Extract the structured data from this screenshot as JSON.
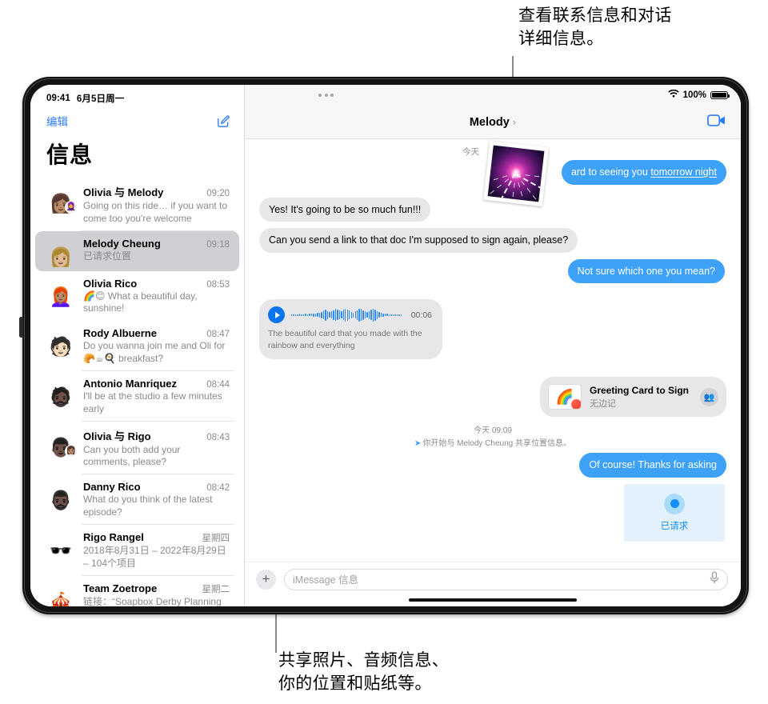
{
  "callouts": {
    "top": "查看联系信息和对话\n详细信息。",
    "bottom": "共享照片、音频信息、\n你的位置和贴纸等。"
  },
  "status_bar": {
    "time": "09:41",
    "date": "6月5日周一",
    "wifi_icon": "wifi-icon",
    "battery_percent": "100%",
    "battery_icon": "battery-icon"
  },
  "sidebar": {
    "edit_label": "编辑",
    "compose_icon": "compose-icon",
    "title": "信息",
    "conversations": [
      {
        "name": "Olivia 与 Melody",
        "time": "09:20",
        "preview": "Going on this ride… if you want to come too you're welcome",
        "avatar": "👩🏽",
        "badge": "🧕",
        "selected": false
      },
      {
        "name": "Melody Cheung",
        "time": "09:18",
        "preview": "已请求位置",
        "avatar": "👩🏼",
        "badge": "",
        "selected": true
      },
      {
        "name": "Olivia Rico",
        "time": "08:53",
        "preview": "🌈😊 What a beautiful day, sunshine!",
        "avatar": "👩🏽‍🦰",
        "badge": "",
        "selected": false
      },
      {
        "name": "Rody Albuerne",
        "time": "08:47",
        "preview": "Do you wanna join me and Oli for 🥐☕🍳 breakfast?",
        "avatar": "🧑🏻",
        "badge": "",
        "selected": false
      },
      {
        "name": "Antonio Manriquez",
        "time": "08:44",
        "preview": "I'll be at the studio a few minutes early",
        "avatar": "🧔🏿",
        "badge": "",
        "selected": false
      },
      {
        "name": "Olivia 与 Rigo",
        "time": "08:43",
        "preview": "Can you both add your comments, please?",
        "avatar": "👨🏿",
        "badge": "👩🏽",
        "selected": false
      },
      {
        "name": "Danny Rico",
        "time": "08:42",
        "preview": "What do you think of the latest episode?",
        "avatar": "🧔🏿‍♂️",
        "badge": "",
        "selected": false
      },
      {
        "name": "Rigo Rangel",
        "time": "星期四",
        "preview": "2018年8月31日 – 2022年8月29日 – 104个项目",
        "avatar": "🕶️",
        "badge": "",
        "selected": false
      },
      {
        "name": "Team Zoetrope",
        "time": "星期二",
        "preview": "链接：“Soapbox Derby Planning Demo Board”共享自 Freefor",
        "avatar": "🎪",
        "badge": "",
        "selected": false
      }
    ]
  },
  "conversation": {
    "title": "Melody",
    "chevron": "›",
    "facetime_icon": "video-camera-icon",
    "multitask_icon": "multitask-dots-icon",
    "date_label": "今天",
    "photo_alt": "fireworks-photo",
    "messages": [
      {
        "type": "out",
        "text": "ard to seeing you tomorrow night",
        "link": "tomorrow night"
      },
      {
        "type": "in",
        "text": "Yes! It's going to be so much fun!!!"
      },
      {
        "type": "in",
        "text": "Can you send a link to that doc I'm supposed to sign again, please?"
      },
      {
        "type": "out",
        "text": "Not sure which one you mean?"
      }
    ],
    "audio_message": {
      "duration": "00:06",
      "transcript": "The beautiful card that you made with the rainbow and everything",
      "play_icon": "play-icon"
    },
    "attachment": {
      "title": "Greeting Card to Sign",
      "subtitle": "无边记",
      "thumb_icon": "rainbow-card-thumbnail",
      "people_icon": "people-icon"
    },
    "system": {
      "time": "今天 09:09",
      "text": "你开始与 Melody Cheung 共享位置信息。",
      "arrow_icon": "location-arrow-icon"
    },
    "final_message": {
      "type": "out",
      "text": "Of course! Thanks for asking"
    },
    "location_card": {
      "label": "已请求",
      "icon": "location-dot-icon"
    }
  },
  "input_bar": {
    "plus_label": "+",
    "placeholder": "iMessage 信息",
    "value": "",
    "mic_icon": "microphone-icon"
  },
  "colors": {
    "accent_blue": "#3da2f7",
    "link_blue": "#2b7cf6",
    "bubble_gray": "#e7e7ea",
    "selected_row": "#cfcfd4"
  }
}
